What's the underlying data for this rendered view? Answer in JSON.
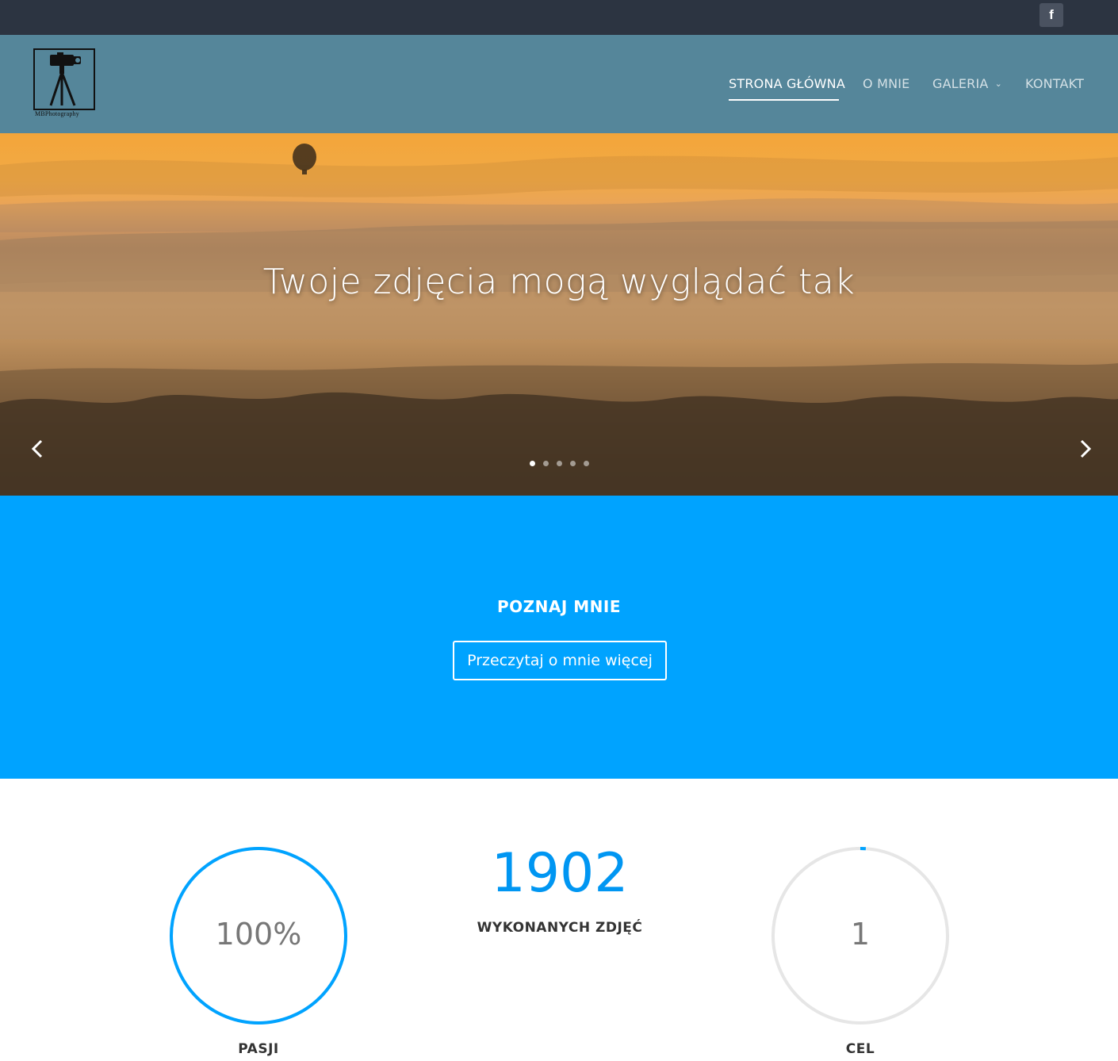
{
  "topbar": {
    "social_icon": "facebook-icon",
    "social_glyph": "f"
  },
  "header": {
    "logo_text": "MBPhotography",
    "nav": [
      {
        "label": "STRONA GŁÓWNA",
        "active": true
      },
      {
        "label": "O MNIE",
        "active": false
      },
      {
        "label": "GALERIA",
        "active": false,
        "has_dropdown": true
      },
      {
        "label": "KONTAKT",
        "active": false
      }
    ]
  },
  "hero": {
    "title": "Twoje zdjęcia mogą wyglądać tak",
    "prev_icon": "chevron-left-icon",
    "next_icon": "chevron-right-icon",
    "slides": 5,
    "active_slide": 1
  },
  "about": {
    "title": "POZNAJ MNIE",
    "button_label": "Przeczytaj o mnie więcej"
  },
  "counters": [
    {
      "value": "100%",
      "label": "PASJI",
      "percent": 100
    },
    {
      "value": "1902",
      "label": "WYKONANYCH ZDJĘĆ"
    },
    {
      "value": "1",
      "label": "CEL",
      "percent": 1
    }
  ],
  "colors": {
    "topbar": "#2c3441",
    "header": "#55869a",
    "accent": "#00a3ff",
    "ring_track": "#e6e6e6"
  }
}
